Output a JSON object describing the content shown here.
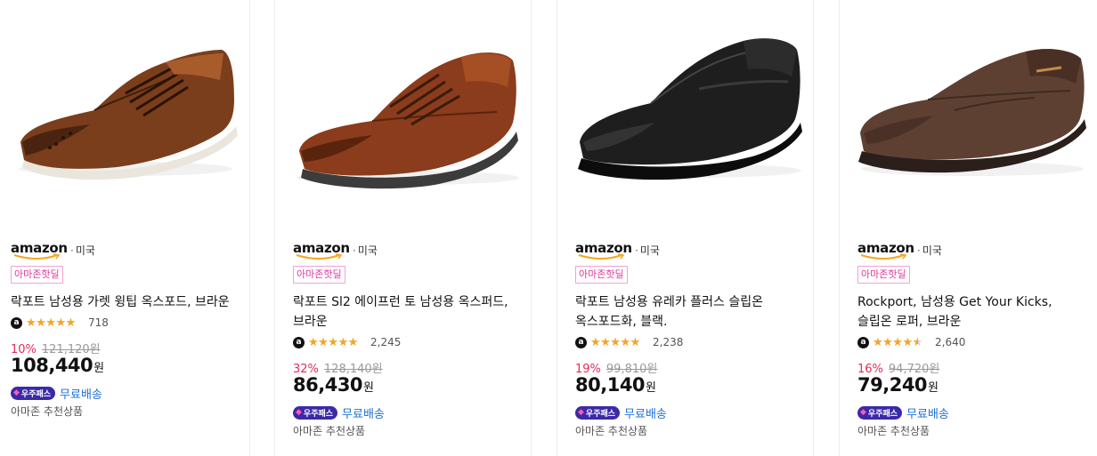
{
  "products": [
    {
      "image_icon": "brown-wingtip-oxford-shoe",
      "brand": "amazon",
      "country": "미국",
      "deal_badge": "아마존핫딜",
      "title": "락포트 남성용 가렛 윙팁 옥스포드, 브라운",
      "rating": 4.5,
      "review_count": "718",
      "discount": "10%",
      "original_price": "121,120원",
      "price": "108,440",
      "currency": "원",
      "pass_label": "우주패스",
      "shipping": "무료배송",
      "recommendation": "아마존 추천상품"
    },
    {
      "image_icon": "brown-moc-toe-oxford-shoe",
      "brand": "amazon",
      "country": "미국",
      "deal_badge": "아마존핫딜",
      "title": "락포트 Sl2 에이프런 토 남성용 옥스퍼드, 브라운",
      "rating": 4.5,
      "review_count": "2,245",
      "discount": "32%",
      "original_price": "128,140원",
      "price": "86,430",
      "currency": "원",
      "pass_label": "우주패스",
      "shipping": "무료배송",
      "recommendation": "아마존 추천상품"
    },
    {
      "image_icon": "black-slip-on-shoe",
      "brand": "amazon",
      "country": "미국",
      "deal_badge": "아마존핫딜",
      "title": "락포트 남성용 유레카 플러스 슬립온 옥스포드화, 블랙.",
      "rating": 4.3,
      "review_count": "2,238",
      "discount": "19%",
      "original_price": "99,810원",
      "price": "80,140",
      "currency": "원",
      "pass_label": "우주패스",
      "shipping": "무료배송",
      "recommendation": "아마존 추천상품"
    },
    {
      "image_icon": "brown-slip-on-loafer",
      "brand": "amazon",
      "country": "미국",
      "deal_badge": "아마존핫딜",
      "title": "Rockport, 남성용 Get Your Kicks, 슬립온 로퍼, 브라운",
      "rating": 4.0,
      "review_count": "2,640",
      "discount": "16%",
      "original_price": "94,720원",
      "price": "79,240",
      "currency": "원",
      "pass_label": "우주패스",
      "shipping": "무료배송",
      "recommendation": "아마존 추천상품"
    }
  ]
}
